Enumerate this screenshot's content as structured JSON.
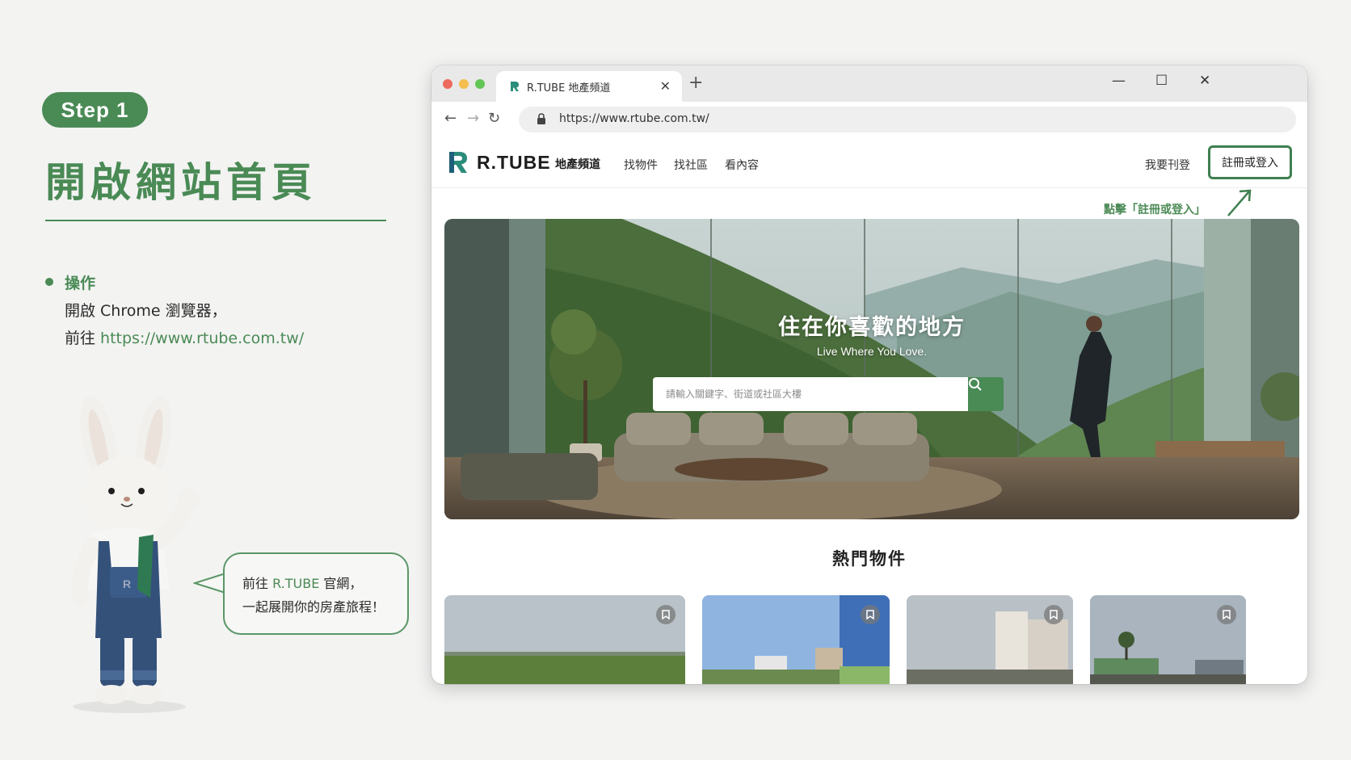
{
  "tutorial": {
    "step_label": "Step 1",
    "title": "開啟網站首頁",
    "operation_label": "操作",
    "instruction_line1": "開啟 Chrome 瀏覽器，",
    "instruction_line2_prefix": "前往 ",
    "instruction_line2_link": "https://www.rtube.com.tw/",
    "bubble_line1_prefix": "前往 ",
    "bubble_line1_highlight": "R.TUBE",
    "bubble_line1_suffix": " 官網，",
    "bubble_line2": "一起展開你的房產旅程！"
  },
  "browser": {
    "tab_title": "R.TUBE 地產頻道",
    "tab_close": "✕",
    "new_tab": "+",
    "url": "https://www.rtube.com.tw/",
    "controls": {
      "minimize": "—",
      "maximize": "☐",
      "close": "✕"
    },
    "nav": {
      "back": "←",
      "forward": "→",
      "reload": "↻"
    }
  },
  "site": {
    "logo_text": "R.TUBE",
    "logo_sub": "地產頻道",
    "nav_items": [
      "找物件",
      "找社區",
      "看內容"
    ],
    "post_link": "我要刊登",
    "login_button": "註冊或登入",
    "annotation": "點擊「註冊或登入」",
    "hero_title": "住在你喜歡的地方",
    "hero_subtitle": "Live Where You Love.",
    "search_placeholder": "請輸入關鍵字、街道或社區大樓",
    "section_title": "熱門物件"
  },
  "colors": {
    "brand_green": "#4a8a55",
    "login_border": "#3f8050",
    "background": "#f3f3f2"
  },
  "icons": [
    "lock-icon",
    "search-icon",
    "bookmark-icon",
    "back-arrow-icon",
    "forward-arrow-icon",
    "reload-icon",
    "arrow-annotation-icon"
  ]
}
